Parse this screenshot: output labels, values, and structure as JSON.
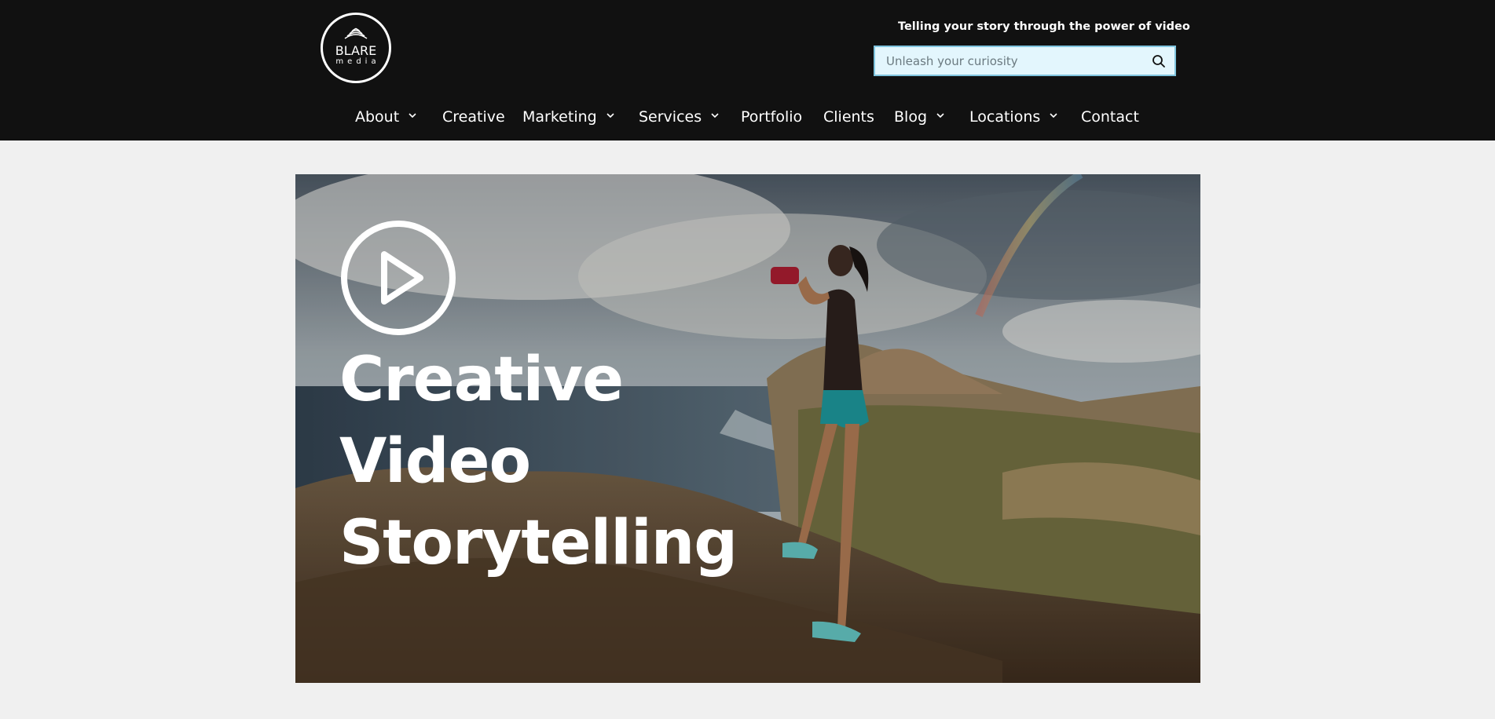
{
  "header": {
    "logo": {
      "main": "BLARE",
      "sub": "media"
    },
    "tagline": "Telling your story through the power of video",
    "search": {
      "placeholder": "Unleash your curiosity",
      "icon": "search-icon"
    }
  },
  "nav": {
    "items": [
      {
        "label": "About",
        "has_dropdown": true
      },
      {
        "label": "Creative",
        "has_dropdown": false
      },
      {
        "label": "Marketing",
        "has_dropdown": true
      },
      {
        "label": "Services",
        "has_dropdown": true
      },
      {
        "label": "Portfolio",
        "has_dropdown": false
      },
      {
        "label": "Clients",
        "has_dropdown": false
      },
      {
        "label": "Blog",
        "has_dropdown": true
      },
      {
        "label": "Locations",
        "has_dropdown": true
      },
      {
        "label": "Contact",
        "has_dropdown": false
      }
    ]
  },
  "hero": {
    "play_icon": "play-icon",
    "headline": [
      "Creative",
      "Video",
      "Storytelling"
    ]
  },
  "colors": {
    "header_bg": "#111111",
    "page_bg": "#f0f0f0",
    "search_bg": "#e3f6fd",
    "search_border": "#7fc4de",
    "text_light": "#ffffff"
  }
}
